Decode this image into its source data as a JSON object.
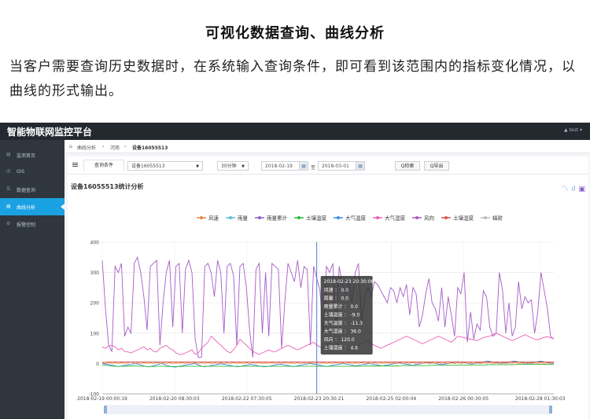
{
  "heading": "可视化数据查询、曲线分析",
  "intro": "当客户需要查询历史数据时，在系统输入查询条件，即可看到该范围内的指标变化情况，以曲线的形式输出。",
  "app": {
    "title": "智能物联网监控平台",
    "user": "▲ test ▾"
  },
  "sidebar": {
    "items": [
      {
        "icon": "▤",
        "icon_name": "monitor-icon",
        "label": "监测首页"
      },
      {
        "icon": "ıll",
        "icon_name": "bars-icon",
        "label": "GIS"
      },
      {
        "icon": "☰",
        "icon_name": "list-icon",
        "label": "数据查询"
      },
      {
        "icon": "▤",
        "icon_name": "chart-icon",
        "label": "曲线分析"
      },
      {
        "icon": "⚙",
        "icon_name": "gear-icon",
        "label": "报警控制"
      }
    ],
    "active_index": 3
  },
  "breadcrumb": {
    "home": "曲线分析",
    "level2": "河南",
    "current": "设备16055513"
  },
  "toolbar": {
    "tab": "查询条件",
    "device": "设备16055513",
    "interval": "30分钟",
    "start_date": "2018-02-19",
    "to": "至",
    "end_date": "2018-03-01",
    "search": "Q检索",
    "export": "Q导出"
  },
  "chart_title": "设备16055513统计分析",
  "tooltip": {
    "time": "2018-02-23 20:30:06",
    "lines": [
      "风速 ： 0.0",
      "雨量 ： 0.0",
      "雨量累计 ： 0.0",
      "土壤温度 ： -9.0",
      "大气温度 ： -11.3",
      "大气湿度 ： 36.0",
      "风向 ： 120.0",
      "土壤湿度 ： 4.6"
    ]
  },
  "chart_data": {
    "type": "line",
    "ylim": [
      -100,
      400
    ],
    "yticks": [
      400,
      300,
      200,
      100,
      0,
      -100
    ],
    "xtick_labels": [
      "2018-02-19 00:00:19",
      "2018-02-20 08:30:03",
      "2018-02-22 07:30:05",
      "2018-02-23 20:30:21",
      "2018-02-25 02:00:04",
      "2018-02-26 00:30:05",
      "2018-02-28 01:30:03"
    ],
    "xtick_positions": [
      0,
      0.16,
      0.32,
      0.48,
      0.64,
      0.8,
      0.97
    ],
    "cursor_position": 0.475,
    "legend": [
      {
        "name": "风速",
        "color": "#e8853d"
      },
      {
        "name": "雨量",
        "color": "#5bc0de"
      },
      {
        "name": "雨量累计",
        "color": "#8e5fd0"
      },
      {
        "name": "土壤温度",
        "color": "#2fb83a"
      },
      {
        "name": "大气温度",
        "color": "#3d8de8"
      },
      {
        "name": "大气湿度",
        "color": "#e85fb4"
      },
      {
        "name": "风向",
        "color": "#a55bc9"
      },
      {
        "name": "土壤湿度",
        "color": "#d9534f"
      },
      {
        "name": "辐射",
        "color": "#bbbbbb"
      }
    ],
    "series": [
      {
        "name": "风向",
        "color": "#a55bc9",
        "values": [
          340,
          180,
          60,
          40,
          320,
          300,
          330,
          90,
          120,
          100,
          330,
          350,
          300,
          220,
          110,
          320,
          330,
          340,
          60,
          200,
          300,
          340,
          120,
          320,
          330,
          100,
          310,
          340,
          300,
          80,
          20,
          20,
          320,
          330,
          300,
          220,
          340,
          300,
          100,
          320,
          330,
          290,
          60,
          320,
          330,
          250,
          110,
          20,
          310,
          330,
          100,
          300,
          90,
          330,
          320,
          310,
          50,
          200,
          330,
          300,
          270,
          340,
          250,
          320,
          310,
          60,
          320,
          280,
          240,
          100,
          320,
          300,
          330,
          120,
          320,
          260,
          230,
          270,
          200,
          300,
          330,
          140,
          220,
          250,
          220,
          270,
          260,
          240,
          220,
          200,
          250,
          240,
          200,
          250,
          220,
          260,
          160,
          250,
          230,
          120,
          160,
          230,
          280,
          200,
          180,
          140,
          250,
          120,
          220,
          160,
          90,
          250,
          230,
          300,
          70,
          170,
          80,
          130,
          110,
          240,
          220,
          120,
          90,
          100,
          300,
          240,
          100,
          200,
          90,
          120,
          270,
          180,
          220,
          200,
          210,
          100,
          170,
          300,
          240,
          180,
          90,
          80
        ]
      },
      {
        "name": "大气湿度",
        "color": "#e85fb4",
        "values": [
          55,
          50,
          58,
          60,
          55,
          45,
          50,
          40,
          38,
          35,
          40,
          45,
          50,
          55,
          45,
          50,
          40,
          38,
          50,
          55,
          60,
          50,
          45,
          35,
          30,
          30,
          35,
          40,
          45,
          30,
          35,
          50,
          60,
          70,
          90,
          80,
          70,
          60,
          50,
          40,
          35,
          45,
          60,
          80,
          70,
          60,
          50,
          40,
          35,
          30,
          35,
          40,
          45,
          40,
          38,
          45,
          50,
          55,
          60,
          55,
          50,
          45,
          50,
          55,
          60,
          65,
          70,
          60,
          55,
          50,
          60,
          70,
          80,
          70,
          60,
          55,
          50,
          45,
          50,
          55,
          60,
          65,
          70,
          75,
          65,
          60,
          55,
          50,
          55,
          60,
          65,
          70,
          75,
          80,
          85,
          90,
          85,
          80,
          75,
          70,
          65,
          70,
          75,
          80,
          85,
          90,
          85,
          80,
          75,
          70,
          80,
          90,
          88,
          85,
          82,
          80,
          78,
          75,
          80,
          85,
          88,
          90,
          95,
          100,
          95,
          90,
          85,
          80,
          75,
          80,
          85,
          90,
          95,
          90,
          85,
          80,
          78,
          82,
          86,
          88,
          85,
          82
        ]
      },
      {
        "name": "大气温度",
        "color": "#3d8de8",
        "values": [
          0,
          -2,
          -4,
          -6,
          -8,
          -10,
          -8,
          -6,
          -4,
          -2,
          0,
          -3,
          -6,
          -9,
          -11,
          -9,
          -6,
          -3,
          0,
          -4,
          -8,
          -10,
          -12,
          -10,
          -8,
          -6,
          -4,
          -2,
          0,
          -4,
          -8,
          -11,
          -9,
          -7,
          -5,
          -3,
          -1,
          -3,
          -5,
          -7,
          -9,
          -11,
          -9,
          -7,
          -5,
          -3,
          -5,
          -7,
          -9,
          -11,
          -10,
          -8,
          -6,
          -4,
          -2,
          -4,
          -6,
          -8,
          -10,
          -8,
          -6,
          -4,
          -2,
          0,
          -2,
          -4,
          -6,
          -8,
          -10,
          -8,
          -6,
          -4,
          -2,
          0,
          -2,
          -4,
          -6,
          -8,
          -6,
          -4,
          -2,
          0,
          -2,
          -4,
          -6,
          -8,
          -6,
          -4,
          -2,
          0,
          2,
          0,
          -2,
          -4,
          -6,
          -4,
          -2,
          0,
          2,
          4,
          2,
          0,
          -2,
          -4,
          -2,
          0,
          2,
          4,
          6,
          4,
          2,
          0,
          -2,
          0,
          2,
          4,
          6,
          8,
          6,
          4,
          2,
          0,
          2,
          4,
          6,
          8,
          6,
          4,
          2,
          0,
          2,
          4,
          6,
          8,
          6,
          4,
          2,
          0
        ]
      },
      {
        "name": "土壤温度",
        "color": "#2fb83a",
        "values": [
          -5,
          -6,
          -7,
          -8,
          -9,
          -9,
          -9,
          -9,
          -8,
          -8,
          -8,
          -9,
          -9,
          -9,
          -10,
          -10,
          -10,
          -9,
          -9,
          -9,
          -10,
          -10,
          -10,
          -10,
          -10,
          -9,
          -9,
          -9,
          -9,
          -9,
          -9,
          -9,
          -9,
          -9,
          -9,
          -9,
          -9,
          -9,
          -9,
          -9,
          -9,
          -9,
          -9,
          -9,
          -9,
          -9,
          -9,
          -9,
          -9,
          -9,
          -9,
          -9,
          -9,
          -9,
          -9,
          -9,
          -9,
          -9,
          -9,
          -9,
          -9,
          -9,
          -9,
          -9,
          -9,
          -9,
          -9,
          -9,
          -9,
          -9,
          -9,
          -9,
          -9,
          -9,
          -9,
          -9,
          -9,
          -9,
          -9,
          -9,
          -9,
          -8,
          -8,
          -8,
          -8,
          -8,
          -8,
          -8,
          -8,
          -8,
          -8,
          -8,
          -7,
          -7,
          -7,
          -7,
          -7,
          -7,
          -7,
          -7,
          -7,
          -6,
          -6,
          -6,
          -6,
          -6,
          -6,
          -6,
          -6,
          -6,
          -5,
          -5,
          -5,
          -5,
          -5,
          -5,
          -5,
          -5,
          -5,
          -4,
          -4,
          -4,
          -4,
          -4,
          -4,
          -4,
          -4,
          -4,
          -3,
          -3,
          -3,
          -3,
          -3,
          -3,
          -3,
          -3,
          -3,
          -3,
          -3,
          -3
        ]
      },
      {
        "name": "风速",
        "color": "#e8853d",
        "values": [
          2,
          0,
          4,
          0,
          2,
          0,
          3,
          0,
          2,
          5,
          0,
          2,
          0,
          3,
          0,
          2,
          0,
          4,
          0,
          2,
          0,
          3,
          0,
          2,
          0,
          4,
          0,
          2,
          0,
          3,
          0,
          2,
          0,
          4,
          0,
          2,
          0,
          3,
          0,
          2,
          0,
          4,
          0,
          2,
          0,
          3,
          0,
          2,
          0,
          4,
          0,
          2,
          0,
          3,
          0,
          2,
          0,
          4,
          0,
          2,
          0,
          3,
          0,
          2,
          0,
          4,
          0,
          2,
          0,
          3,
          0,
          2,
          0,
          4,
          0,
          2,
          0,
          3,
          0,
          2,
          0,
          4,
          0,
          2,
          0,
          3,
          0,
          2,
          0,
          4,
          0,
          2,
          0,
          3,
          0,
          2,
          0,
          4,
          0,
          2,
          0,
          3,
          0,
          2,
          0,
          4,
          0,
          2,
          0,
          3,
          0,
          2,
          0,
          4,
          0,
          2,
          0,
          3,
          0,
          2,
          0,
          4,
          0,
          2,
          0,
          3,
          0,
          2,
          0,
          4,
          0,
          2,
          0,
          3,
          0,
          2,
          0,
          4,
          0,
          2,
          0,
          3
        ]
      },
      {
        "name": "土壤湿度",
        "color": "#d9534f",
        "values": [
          4,
          4,
          5,
          5,
          5,
          5,
          5,
          5,
          5,
          5,
          5,
          5,
          5,
          5,
          5,
          5,
          5,
          5,
          5,
          5,
          5,
          5,
          5,
          5,
          5,
          5,
          5,
          5,
          5,
          5,
          5,
          5,
          5,
          5,
          5,
          5,
          5,
          5,
          5,
          5,
          5,
          5,
          5,
          5,
          5,
          5,
          5,
          5,
          5,
          5,
          5,
          5,
          5,
          5,
          5,
          5,
          5,
          5,
          5,
          5,
          5,
          5,
          5,
          5,
          5,
          5,
          5,
          5,
          5,
          5,
          5,
          5,
          5,
          5,
          5,
          5,
          5,
          5,
          5,
          5,
          5,
          5,
          5,
          5,
          5,
          5,
          5,
          5,
          5,
          5,
          5,
          5,
          5,
          5,
          5,
          5,
          5,
          5,
          5,
          5,
          5,
          5,
          5,
          5,
          5,
          5,
          5,
          5,
          5,
          5,
          5,
          5,
          5,
          5,
          5,
          5,
          5,
          5,
          5,
          5,
          5,
          5,
          5,
          5,
          5,
          5,
          5,
          5,
          5,
          5,
          5,
          5,
          5,
          5,
          5,
          5,
          5,
          5,
          5,
          5,
          5,
          5
        ]
      }
    ]
  }
}
